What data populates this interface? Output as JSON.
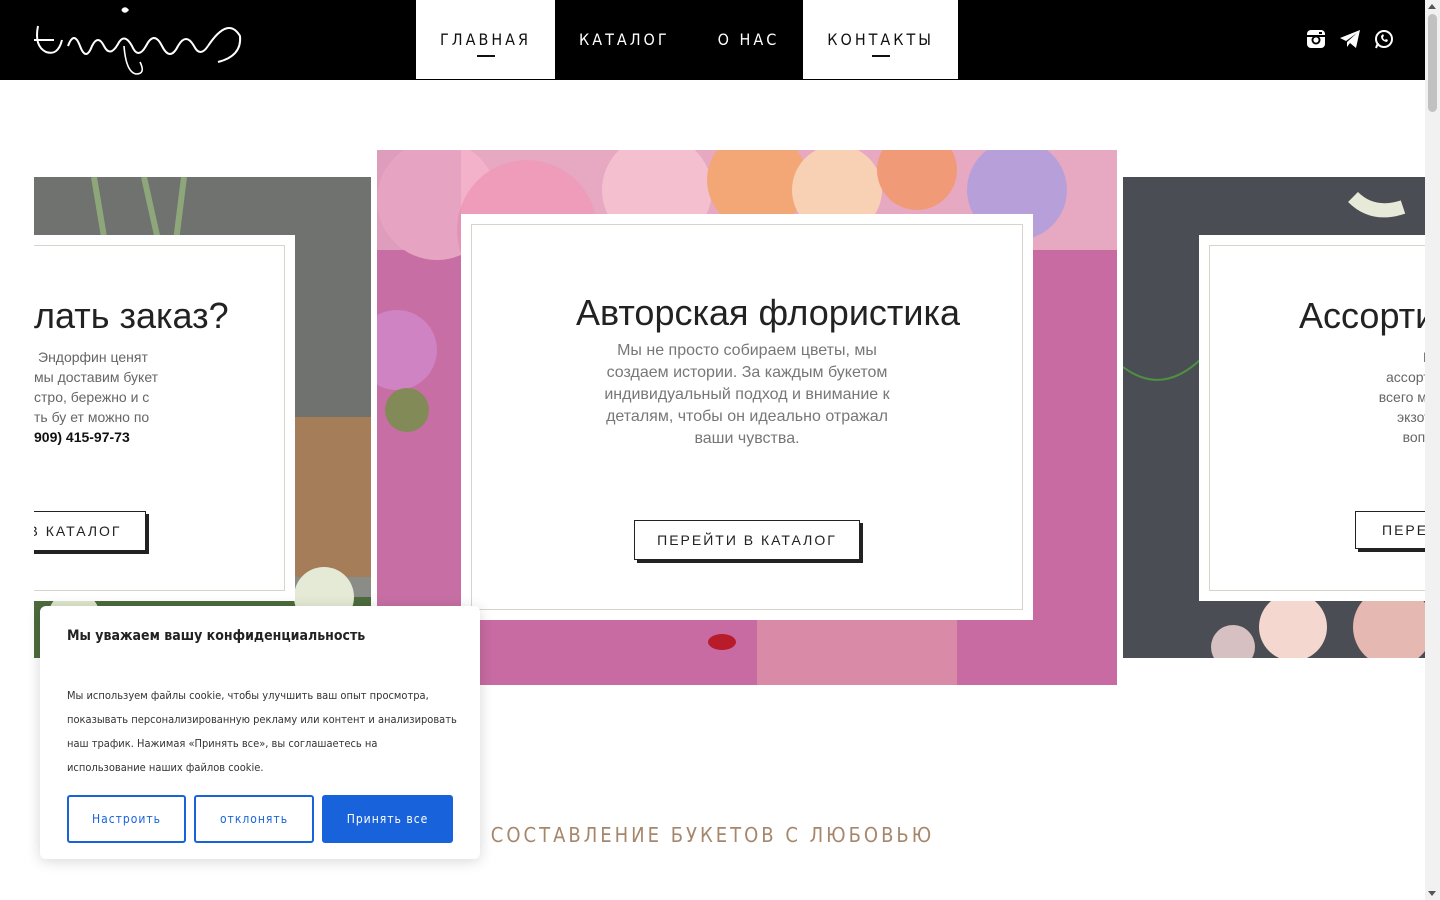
{
  "header": {
    "logo_text": "Эндорфин",
    "nav": [
      {
        "label": "ГЛАВНАЯ"
      },
      {
        "label": "КАТАЛОГ"
      },
      {
        "label": "О НАС"
      },
      {
        "label": "КОНТАКТЫ"
      }
    ],
    "social_icons": [
      "instagram-icon",
      "telegram-icon",
      "whatsapp-icon"
    ]
  },
  "slides": {
    "left": {
      "title": "лать заказ?",
      "lines": [
        "Эндорфин ценят",
        "мы доставим букет",
        "стро, бережно и с",
        "ть бу ет можно по"
      ],
      "phone": "909) 415-97-73",
      "button": "В КАТАЛОГ"
    },
    "center": {
      "title": "Авторская флористика",
      "text": "Мы не просто собираем цветы, мы создаем истории. За каждым букетом индивидуальный подход и внимание к деталям, чтобы он идеально отражал ваши чувства.",
      "button": "ПЕРЕЙТИ В КАТАЛОГ"
    },
    "right": {
      "title": "Ассорти",
      "lines": [
        "Мы гор",
        "ассортимент",
        "всего мира. О",
        "экзотики. У",
        "воплотить"
      ],
      "button": "ПЕРЕЙ"
    }
  },
  "section": {
    "title": "СОСТАВЛЕНИЕ БУКЕТОВ С ЛЮБОВЬЮ"
  },
  "cookie": {
    "title": "Мы уважаем вашу конфиденциальность",
    "text": "Мы используем файлы cookie, чтобы улучшить ваш опыт просмотра, показывать персонализированную рекламу или контент и анализировать наш трафик. Нажимая «Принять все», вы соглашаетесь на использование наших файлов cookie.",
    "buttons": {
      "customize": "Настроить",
      "reject": "отклонять",
      "accept": "Принять все"
    },
    "accent_color": "#1863dc"
  },
  "colors": {
    "header_bg": "#000000",
    "section_title": "#a6876c"
  }
}
